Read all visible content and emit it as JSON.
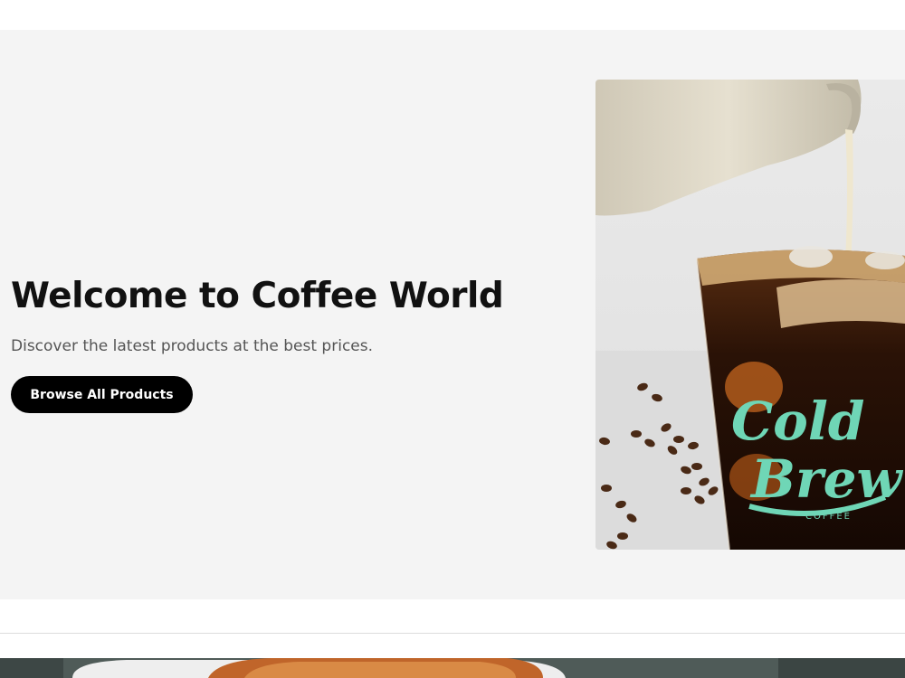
{
  "hero": {
    "title": "Welcome to Coffee World",
    "subtitle": "Discover the latest products at the best prices.",
    "button_label": "Browse All Products",
    "image": {
      "logo_text_line1": "Cold",
      "logo_text_line2": "Brew",
      "logo_text_line3": "COFFEE",
      "logo_color": "#6fd6b6"
    }
  },
  "colors": {
    "hero_background": "#f4f4f4",
    "button_background": "#000000",
    "button_text": "#ffffff",
    "title_text": "#111111",
    "subtitle_text": "#555555"
  }
}
